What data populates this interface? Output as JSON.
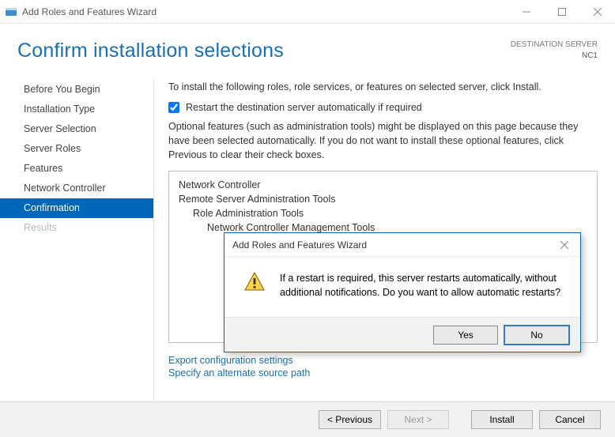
{
  "window": {
    "title": "Add Roles and Features Wizard"
  },
  "header": {
    "title": "Confirm installation selections",
    "destination_label": "DESTINATION SERVER",
    "destination_value": "NC1"
  },
  "sidebar": {
    "items": [
      {
        "label": "Before You Begin"
      },
      {
        "label": "Installation Type"
      },
      {
        "label": "Server Selection"
      },
      {
        "label": "Server Roles"
      },
      {
        "label": "Features"
      },
      {
        "label": "Network Controller"
      },
      {
        "label": "Confirmation"
      },
      {
        "label": "Results"
      }
    ]
  },
  "content": {
    "intro": "To install the following roles, role services, or features on selected server, click Install.",
    "restart_checkbox_label": "Restart the destination server automatically if required",
    "restart_checked": true,
    "optional_note": "Optional features (such as administration tools) might be displayed on this page because they have been selected automatically. If you do not want to install these optional features, click Previous to clear their check boxes.",
    "selections": [
      {
        "label": "Network Controller",
        "indent": 0
      },
      {
        "label": "Remote Server Administration Tools",
        "indent": 0
      },
      {
        "label": "Role Administration Tools",
        "indent": 1
      },
      {
        "label": "Network Controller Management Tools",
        "indent": 2
      }
    ],
    "links": {
      "export": "Export configuration settings",
      "source_path": "Specify an alternate source path"
    }
  },
  "footer": {
    "previous": "< Previous",
    "next": "Next >",
    "install": "Install",
    "cancel": "Cancel"
  },
  "modal": {
    "title": "Add Roles and Features Wizard",
    "message": "If a restart is required, this server restarts automatically, without additional notifications. Do you want to allow automatic restarts?",
    "yes": "Yes",
    "no": "No"
  }
}
